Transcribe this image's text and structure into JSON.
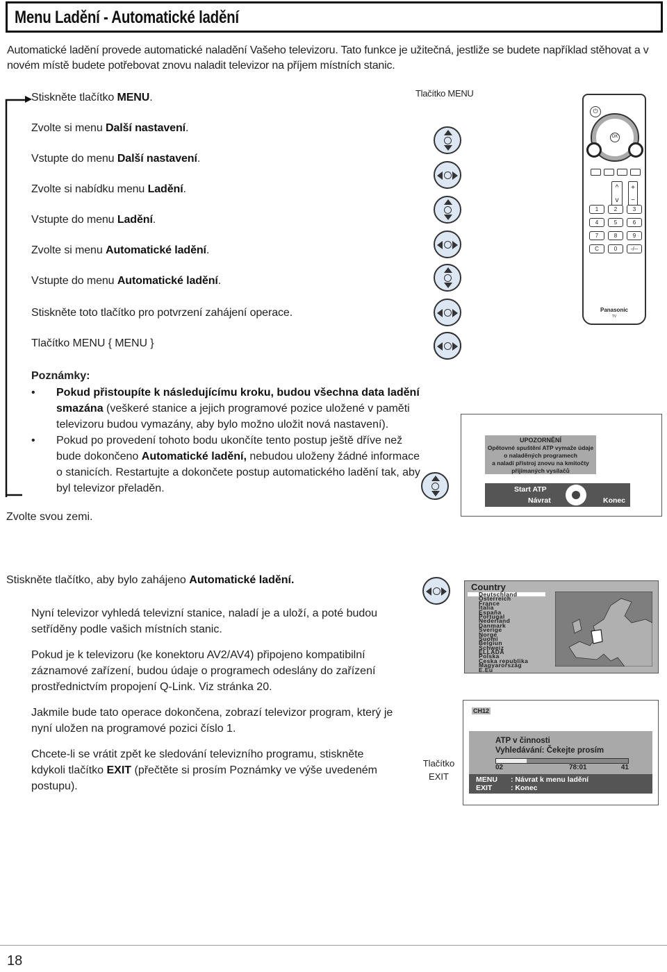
{
  "header": {
    "title": "Menu Ladění - Automatické ladění"
  },
  "intro": "Automatické ladění provede automatické naladění Vašeho televizoru. Tato funkce je užitečná, jestliže se budete například stěhovat a v novém místě budete potřebovat znovu naladit televizor na příjem místních stanic.",
  "steps": [
    {
      "text": "Stiskněte tlačítko ",
      "bold": "MENU",
      "end": ".",
      "icon": null
    },
    {
      "text": "Zvolte si menu ",
      "bold": "Další nastavení",
      "end": ".",
      "icon": "up-down-nav-icon"
    },
    {
      "text": "Vstupte do menu ",
      "bold": "Další nastavení",
      "end": ".",
      "icon": "left-right-nav-icon"
    },
    {
      "text": "Zvolte si nabídku menu ",
      "bold": "Ladění",
      "end": ".",
      "icon": "up-down-nav-icon"
    },
    {
      "text": "Vstupte do menu ",
      "bold": "Ladění",
      "end": ".",
      "icon": "left-right-nav-icon"
    },
    {
      "text": "Zvolte si menu ",
      "bold": "Automatické ladění",
      "end": ".",
      "icon": "up-down-nav-icon"
    },
    {
      "text": "Vstupte do menu ",
      "bold": "Automatické ladění",
      "end": ".",
      "icon": "left-right-nav-icon"
    },
    {
      "text": "Stiskněte toto tlačítko pro potvrzení zahájení operace.",
      "bold": "",
      "end": "",
      "icon": "left-right-nav-icon"
    },
    {
      "text": "Tlačítko MENU { MENU }",
      "bold": "",
      "end": "",
      "icon": "left-right-nav-icon"
    }
  ],
  "menu_button_label": "Tlačítko MENU",
  "remote": {
    "brand": "Panasonic",
    "sub": "TV",
    "keys": [
      "1",
      "2",
      "3",
      "4",
      "5",
      "6",
      "7",
      "8",
      "9",
      "C",
      "0",
      "-/--"
    ]
  },
  "notes": {
    "heading": "Poznámky:",
    "item1_bold": "Pokud přistoupíte k následujícímu kroku, budou všechna data ladění smazána",
    "item1_rest": " (veškeré stanice a jejich programové pozice uložené v paměti televizoru budou vymazány, aby bylo možno uložit nová nastavení).",
    "item2_start": "Pokud po provedení tohoto bodu ukončíte tento postup ještě dříve než bude dokončeno ",
    "item2_bold": "Automatické ladění,",
    "item2_rest": " nebudou uloženy žádné informace o stanicích. Restartujte a dokončete postup automatického ladění tak, aby byl televizor přeladěn."
  },
  "choose_country": "Zvolte svou zemi.",
  "warning": {
    "title": "UPOZORNĚNÍ",
    "lines": [
      "Opětovné spuštění ATP vymaže údaje",
      "o naladěných programech",
      "a naladí přístroj znovu na kmitočty",
      "přijímaných vysílačů"
    ],
    "start": "Start ATP",
    "back": "Návrat",
    "exit": "Konec"
  },
  "section2": {
    "lead": "Stiskněte tlačítko, aby bylo zahájeno ",
    "lead_bold": "Automatické ladění.",
    "p1": "Nyní televizor vyhledá televizní stanice, naladí je a uloží, a poté budou setříděny podle vašich místních stanic.",
    "p2": "Pokud je k televizoru (ke konektoru AV2/AV4) připojeno kompatibilní záznamové zařízení, budou údaje o programech odeslány do zařízení prostřednictvím propojení Q-Link. Viz stránka 20.",
    "p3": "Jakmile bude tato operace dokončena, zobrazí televizor program, který je nyní uložen na programové pozici číslo 1.",
    "p4_start": "Chcete-li se vrátit zpět ke sledování televizního programu, stiskněte kdykoli tlačítko ",
    "p4_bold": "EXIT",
    "p4_rest": " (přečtěte si prosím Poznámky ve výše uvedeném postupu).",
    "exit_label_1": "Tlačítko",
    "exit_label_2": "EXIT"
  },
  "country_menu": {
    "title": "Country",
    "selected": "Deutschland",
    "items": [
      "Deutschland",
      "Österreich",
      "France",
      "Italia",
      "España",
      "Portugal",
      "Nederland",
      "Danmark",
      "Sverige",
      "Norge",
      "Suomi",
      "Belgiun",
      "Schweiz",
      "ELLADA",
      "Polska",
      "Ceska republika",
      "Magyarország",
      "E.Eu"
    ]
  },
  "atp": {
    "channel": "CH12",
    "line1": "ATP v činnosti",
    "line2": "Vyhledávání: Čekejte prosím",
    "progress_fraction": 0.23,
    "start": "02",
    "mid": "78:01",
    "end": "41",
    "menu_key": "MENU",
    "menu_sep": ":",
    "menu_action": "Návrat k menu ladění",
    "exit_key": "EXIT",
    "exit_sep": ":",
    "exit_action": "Konec"
  },
  "footer": {
    "page_number": "18"
  },
  "colors": {
    "nav_icon_fill": "#dde7f3",
    "osd_gray": "#a9a9a9",
    "osd_dark": "#555555"
  }
}
